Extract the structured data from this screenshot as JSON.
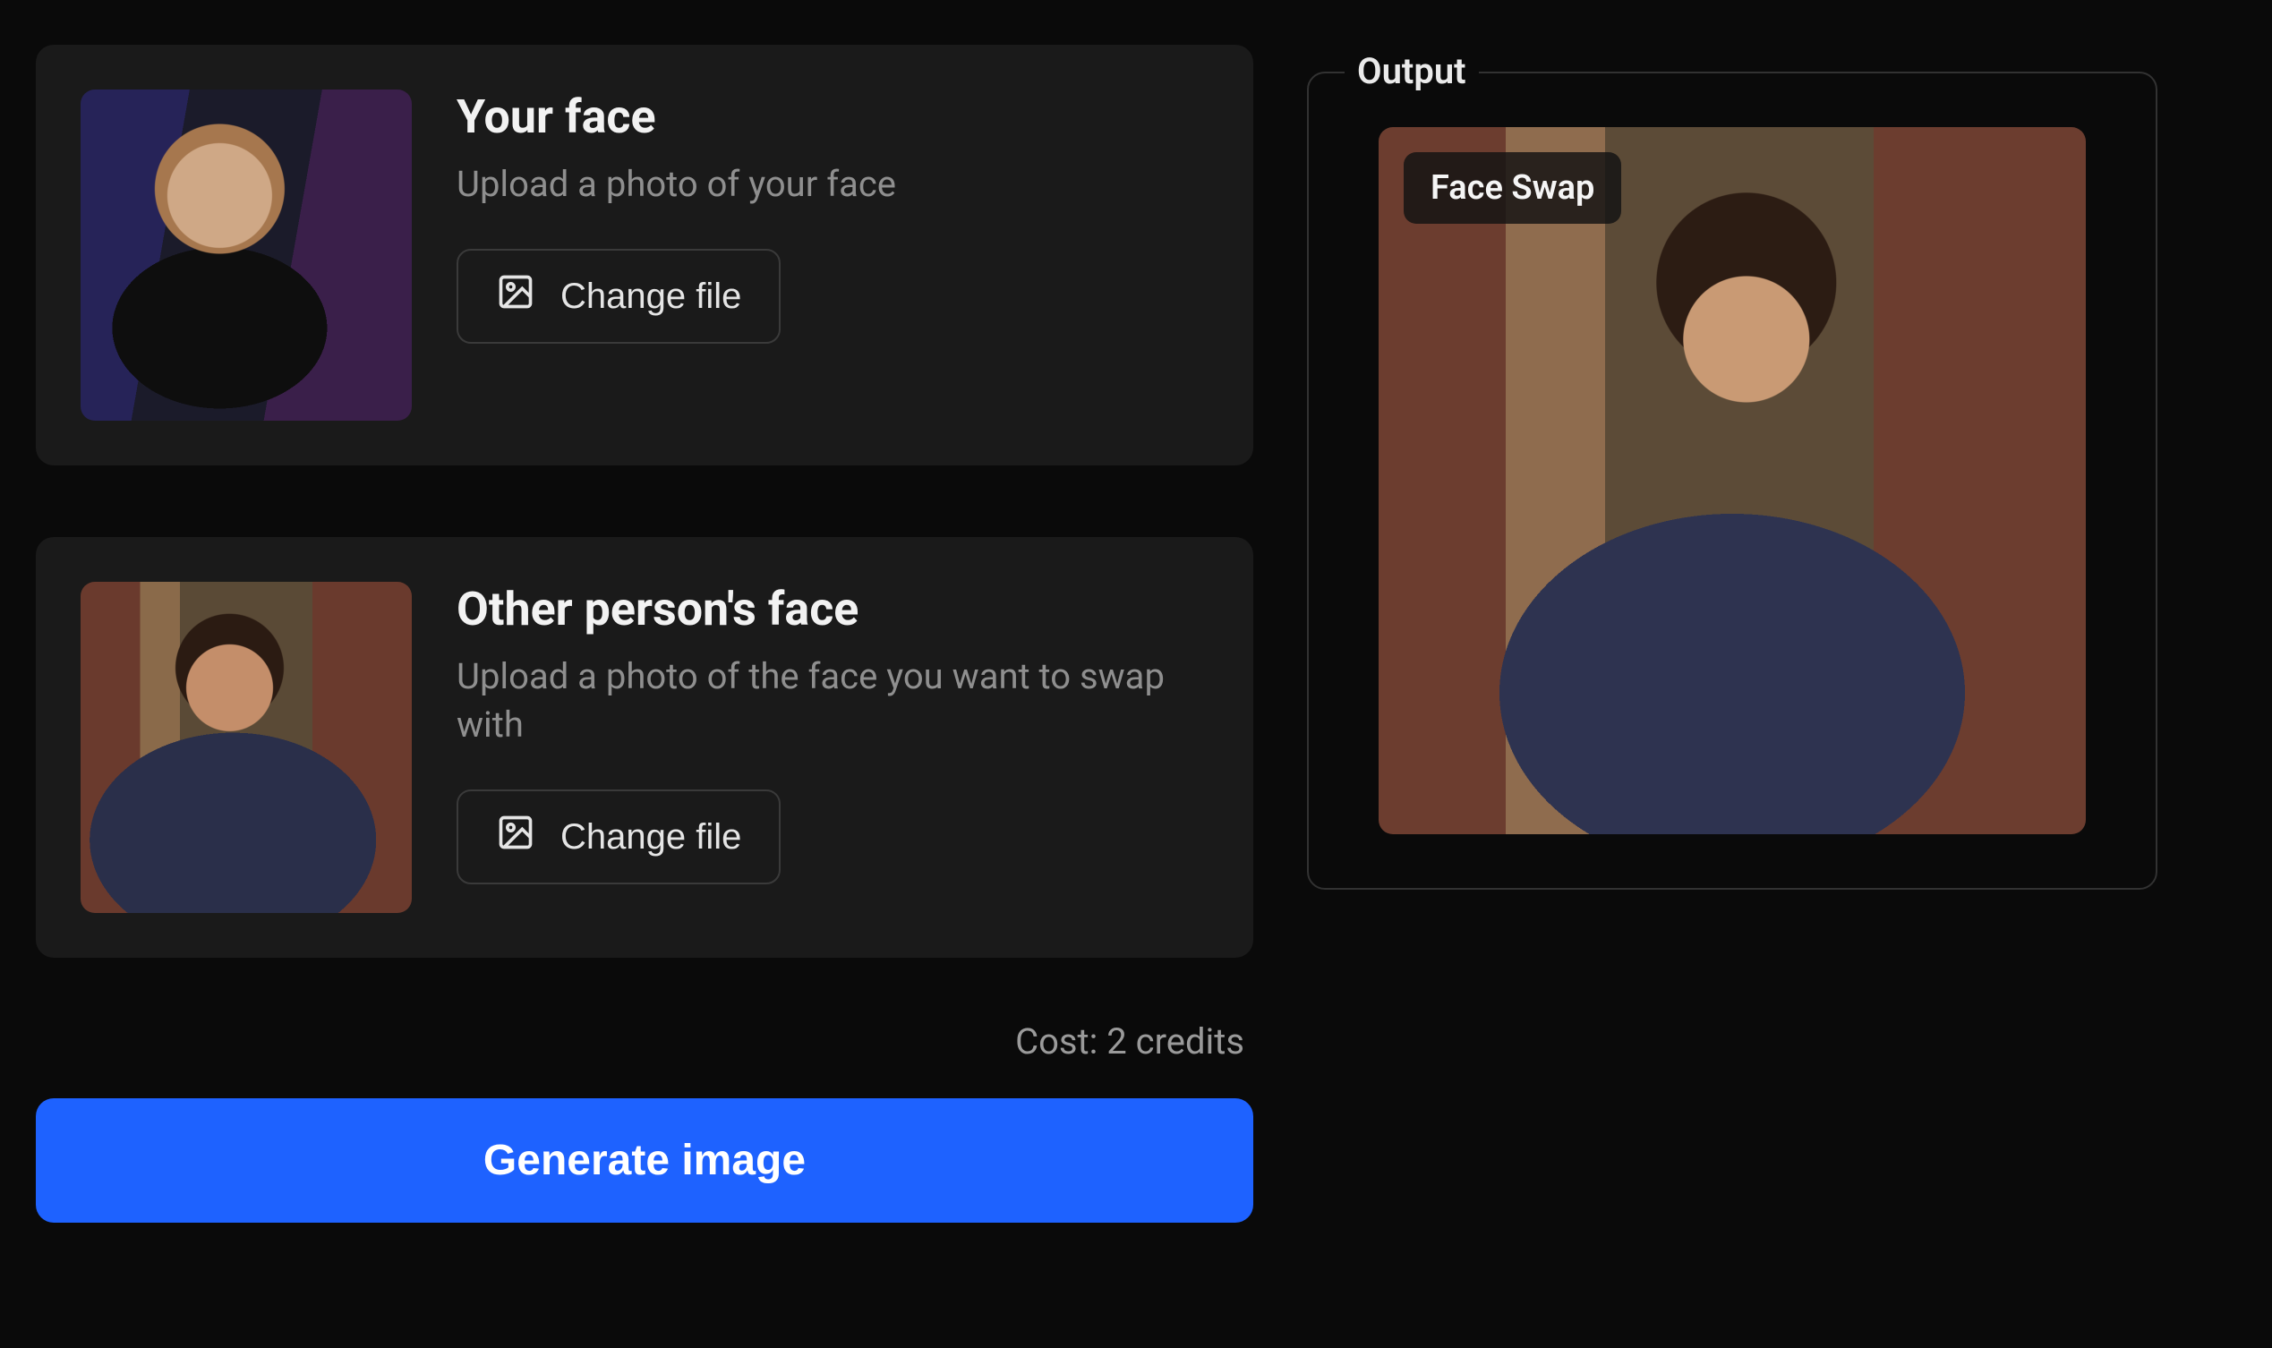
{
  "inputs": {
    "your_face": {
      "title": "Your face",
      "subtitle": "Upload a photo of your face",
      "change_label": "Change file"
    },
    "other_face": {
      "title": "Other person's face",
      "subtitle": "Upload a photo of the face you want to swap with",
      "change_label": "Change file"
    }
  },
  "cost_line": "Cost: 2 credits",
  "generate_label": "Generate image",
  "output": {
    "legend": "Output",
    "badge": "Face Swap"
  }
}
